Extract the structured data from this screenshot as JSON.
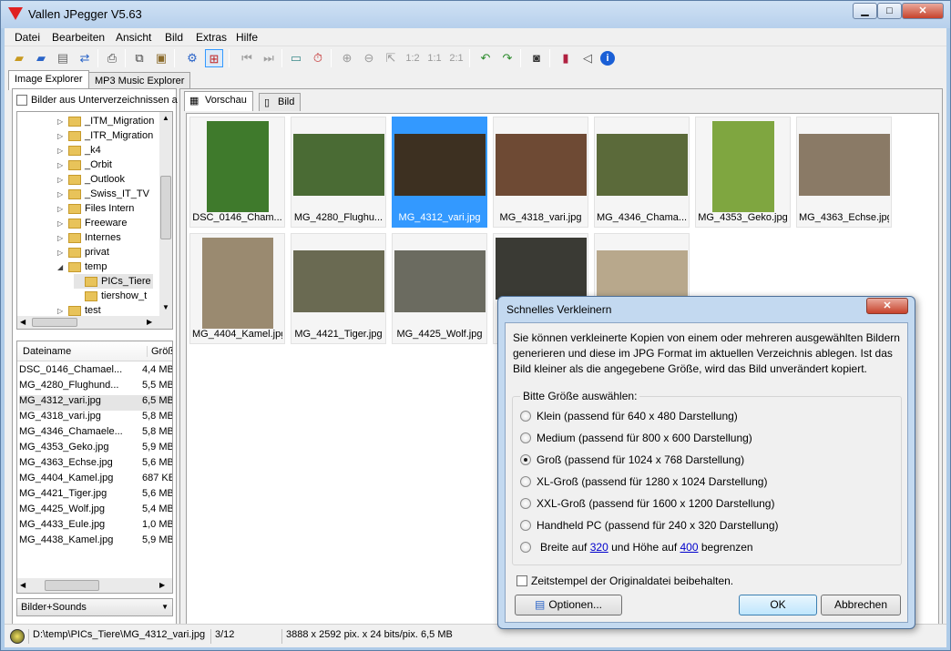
{
  "window": {
    "title": "Vallen JPegger V5.63",
    "min_label": "▁",
    "max_label": "□",
    "close_label": "✕"
  },
  "menu": [
    "Datei",
    "Bearbeiten",
    "Ansicht",
    "Bild",
    "Extras",
    "Hilfe"
  ],
  "toolbar_icons": [
    "open-folder-icon",
    "open-folder-icon",
    "rename-icon",
    "convert-icon",
    "print-icon",
    "copy-icon",
    "paste-icon",
    "settings-icon",
    "slideshow-icon",
    "previous-icon",
    "next-icon",
    "fullscreen-icon",
    "timer-icon",
    "zoom-in-icon",
    "zoom-out-icon",
    "fit-icon",
    "zoom-1-2-icon",
    "zoom-1-1-icon",
    "zoom-2-1-icon",
    "rotate-left-icon",
    "rotate-right-icon",
    "camera-icon",
    "book-icon",
    "sound-icon",
    "info-icon"
  ],
  "toolbar_zoom_labels": [
    "1:2",
    "1:1",
    "2:1"
  ],
  "explorer_tabs": [
    "Image Explorer",
    "MP3 Music Explorer"
  ],
  "left": {
    "subdir_label": "Bilder aus Unterverzeichnissen a",
    "tree": [
      "_ITM_Migration",
      "_ITR_Migration",
      "_k4",
      "_Orbit",
      "_Outlook",
      "_Swiss_IT_TV",
      "Files Intern",
      "Freeware",
      "Internes",
      "privat",
      "temp",
      "PICs_Tiere",
      "tiershow_t",
      "test"
    ],
    "col_name": "Dateiname",
    "col_size": "Größ",
    "files": [
      {
        "name": "DSC_0146_Chamael...",
        "size": "4,4 MB"
      },
      {
        "name": "MG_4280_Flughund...",
        "size": "5,5 MB"
      },
      {
        "name": "MG_4312_vari.jpg",
        "size": "6,5 MB"
      },
      {
        "name": "MG_4318_vari.jpg",
        "size": "5,8 MB"
      },
      {
        "name": "MG_4346_Chamaele...",
        "size": "5,8 MB"
      },
      {
        "name": "MG_4353_Geko.jpg",
        "size": "5,9 MB"
      },
      {
        "name": "MG_4363_Echse.jpg",
        "size": "5,6 MB"
      },
      {
        "name": "MG_4404_Kamel.jpg",
        "size": "687 KB"
      },
      {
        "name": "MG_4421_Tiger.jpg",
        "size": "5,6 MB"
      },
      {
        "name": "MG_4425_Wolf.jpg",
        "size": "5,4 MB"
      },
      {
        "name": "MG_4433_Eule.jpg",
        "size": "1,0 MB"
      },
      {
        "name": "MG_4438_Kamel.jpg",
        "size": "5,9 MB"
      }
    ],
    "filter": "Bilder+Sounds"
  },
  "view_tabs": [
    "Vorschau",
    "Bild"
  ],
  "thumbs": [
    {
      "caption": "DSC_0146_Cham...",
      "color": "#3f7a2c"
    },
    {
      "caption": "MG_4280_Flughu...",
      "color": "#4a6b34"
    },
    {
      "caption": "MG_4312_vari.jpg",
      "color": "#3d3021"
    },
    {
      "caption": "MG_4318_vari.jpg",
      "color": "#6e4a34"
    },
    {
      "caption": "MG_4346_Chama...",
      "color": "#5b6a3a"
    },
    {
      "caption": "MG_4353_Geko.jpg",
      "color": "#7fa640"
    },
    {
      "caption": "MG_4363_Echse.jpg",
      "color": "#8a7a66"
    },
    {
      "caption": "MG_4404_Kamel.jpg",
      "color": "#9a8a70"
    },
    {
      "caption": "MG_4421_Tiger.jpg",
      "color": "#6a6a52"
    },
    {
      "caption": "MG_4425_Wolf.jpg",
      "color": "#6b6b60"
    },
    {
      "caption": "",
      "color": "#3a3a34"
    },
    {
      "caption": "",
      "color": "#b8a88c"
    }
  ],
  "status": {
    "path": "D:\\temp\\PICs_Tiere\\MG_4312_vari.jpg",
    "index": "3/12",
    "info": "3888 x 2592 pix. x 24 bits/pix. 6,5 MB"
  },
  "dialog": {
    "title": "Schnelles Verkleinern",
    "close_label": "✕",
    "description": "Sie können verkleinerte Kopien von einem oder mehreren ausgewählten Bildern generieren und diese im JPG Format im aktuellen Verzeichnis ablegen. Ist das Bild kleiner als die angegebene Größe, wird das Bild unverändert kopiert.",
    "size_legend": "Bitte Größe auswählen:",
    "options": [
      "Klein (passend für 640 x 480 Darstellung)",
      "Medium (passend für 800 x 600 Darstellung)",
      "Groß (passend für 1024 x 768 Darstellung)",
      "XL-Groß (passend für 1280 x 1024 Darstellung)",
      "XXL-Groß (passend für 1600 x 1200 Darstellung)",
      "Handheld PC (passend für 240 x 320 Darstellung)"
    ],
    "selected_index": 2,
    "custom_prefix": "Breite auf",
    "custom_width": "320",
    "custom_mid": "und Höhe auf",
    "custom_height": "400",
    "custom_suffix": "begrenzen",
    "timestamp_label": "Zeitstempel der Originaldatei beibehalten.",
    "options_button": "Optionen...",
    "ok_button": "OK",
    "cancel_button": "Abbrechen"
  }
}
